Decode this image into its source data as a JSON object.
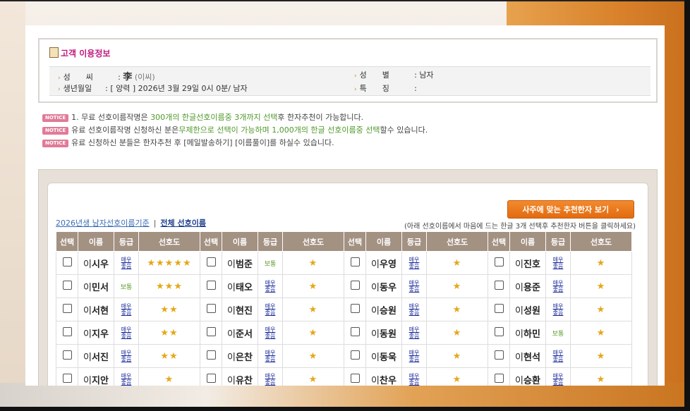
{
  "info": {
    "title": "고객 이용정보",
    "surname_label": "성　　씨",
    "surname_hanja": "李",
    "surname_hangul": "(이씨)",
    "gender_label": "성　　별",
    "gender_value": "남자",
    "birth_label": "생년월일",
    "birth_value": "[ 양력 ] 2026년 3월 29일 0시 0분/ 남자",
    "feature_label": "특　　징",
    "feature_value": ""
  },
  "notices": {
    "badge": "NOTICE",
    "n1a": "1. 무료 선호이름작명은 ",
    "n1b": "300개의 한글선호이름중 3개까지 선택",
    "n1c": "후 한자추천이 가능합니다.",
    "n2a": "유료 선호이름작명 신청하신 분은",
    "n2b": "무제한으로 선택이 가능하며 1,000개의 한글 선호이름중 선택",
    "n2c": "할수 있습니다.",
    "n3": "유료 신청하신 분들은 한자추천 후 [메일발송하기] [이름풀이]를 하실수 있습니다."
  },
  "panel": {
    "rec_button": "사주에 맞는 추천한자 보기",
    "tab1": "2026년생 남자선호이름기준",
    "tab_sep": "|",
    "tab2": "전체 선호이름",
    "hint": "(아래 선호이름에서 마음에 드는 한글 3개 선택후 추천한자 버튼을 클릭하세요)"
  },
  "table": {
    "headers": [
      "선택",
      "이름",
      "등급",
      "선호도"
    ],
    "grade_good": "매우좋음",
    "grade_normal": "보통",
    "rows": [
      [
        {
          "surname": "이",
          "name": "시우",
          "grade": "매우좋음",
          "stars": 5
        },
        {
          "surname": "이",
          "name": "범준",
          "grade": "보통",
          "stars": 1
        },
        {
          "surname": "이",
          "name": "우영",
          "grade": "매우좋음",
          "stars": 1
        },
        {
          "surname": "이",
          "name": "진호",
          "grade": "매우좋음",
          "stars": 1
        }
      ],
      [
        {
          "surname": "이",
          "name": "민서",
          "grade": "보통",
          "stars": 3
        },
        {
          "surname": "이",
          "name": "태오",
          "grade": "매우좋음",
          "stars": 1
        },
        {
          "surname": "이",
          "name": "동우",
          "grade": "매우좋음",
          "stars": 1
        },
        {
          "surname": "이",
          "name": "용준",
          "grade": "매우좋음",
          "stars": 1
        }
      ],
      [
        {
          "surname": "이",
          "name": "서현",
          "grade": "매우좋음",
          "stars": 2
        },
        {
          "surname": "이",
          "name": "현진",
          "grade": "매우좋음",
          "stars": 1
        },
        {
          "surname": "이",
          "name": "승원",
          "grade": "매우좋음",
          "stars": 1
        },
        {
          "surname": "이",
          "name": "성원",
          "grade": "매우좋음",
          "stars": 1
        }
      ],
      [
        {
          "surname": "이",
          "name": "지우",
          "grade": "매우좋음",
          "stars": 2
        },
        {
          "surname": "이",
          "name": "준서",
          "grade": "매우좋음",
          "stars": 1
        },
        {
          "surname": "이",
          "name": "동원",
          "grade": "매우좋음",
          "stars": 1
        },
        {
          "surname": "이",
          "name": "하민",
          "grade": "보통",
          "stars": 1
        }
      ],
      [
        {
          "surname": "이",
          "name": "서진",
          "grade": "매우좋음",
          "stars": 2
        },
        {
          "surname": "이",
          "name": "은찬",
          "grade": "매우좋음",
          "stars": 1
        },
        {
          "surname": "이",
          "name": "동욱",
          "grade": "매우좋음",
          "stars": 1
        },
        {
          "surname": "이",
          "name": "현석",
          "grade": "매우좋음",
          "stars": 1
        }
      ],
      [
        {
          "surname": "이",
          "name": "지안",
          "grade": "매우좋음",
          "stars": 1
        },
        {
          "surname": "이",
          "name": "유찬",
          "grade": "매우좋음",
          "stars": 1
        },
        {
          "surname": "이",
          "name": "찬우",
          "grade": "매우좋음",
          "stars": 1
        },
        {
          "surname": "이",
          "name": "승환",
          "grade": "매우좋음",
          "stars": 1
        }
      ]
    ]
  },
  "colors": {
    "header_bg": "#a39182",
    "accent_orange": "#e26b10",
    "notice_pink": "#e07b97",
    "grade_good": "#1a2a9a",
    "grade_normal": "#5a9a2a",
    "star": "#e4a817"
  }
}
